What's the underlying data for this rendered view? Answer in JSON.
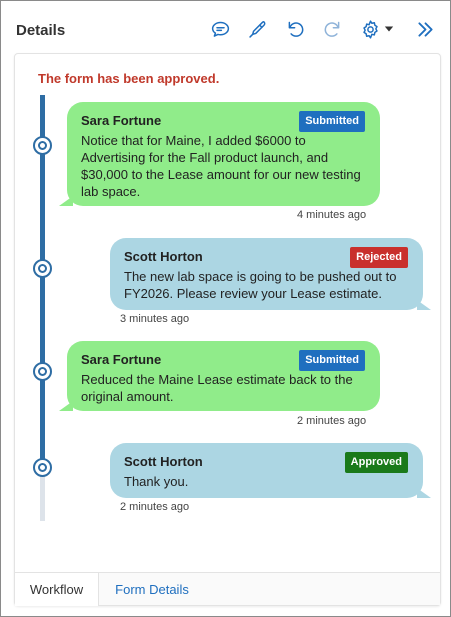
{
  "header": {
    "title": "Details",
    "icons": [
      "comment-icon",
      "edit-pen-icon",
      "undo-icon",
      "redo-icon",
      "gear-icon",
      "dropdown-caret-icon",
      "collapse-right-icon"
    ],
    "accent_color": "#1f6fbf"
  },
  "panel": {
    "status_message": "The form has been approved.",
    "entries": [
      {
        "author": "Sara Fortune",
        "status": "Submitted",
        "message": "Notice that for Maine, I added $6000 to Advertising for the Fall product launch, and $30,000 to the Lease amount for our new testing lab space.",
        "time": "4 minutes ago"
      },
      {
        "author": "Scott Horton",
        "status": "Rejected",
        "message": "The new lab space is going to be pushed out to FY2026. Please review your Lease estimate.",
        "time": "3 minutes ago"
      },
      {
        "author": "Sara Fortune",
        "status": "Submitted",
        "message": "Reduced the Maine Lease estimate back to the original amount.",
        "time": "2 minutes ago"
      },
      {
        "author": "Scott Horton",
        "status": "Approved",
        "message": "Thank you.",
        "time": "2 minutes ago"
      }
    ]
  },
  "tabs": {
    "workflow": "Workflow",
    "form_details": "Form Details"
  },
  "colors": {
    "green_bubble": "#90ec8a",
    "blue_bubble": "#acd6e3",
    "timeline": "#2e6da4",
    "status_message": "#c0392b"
  }
}
